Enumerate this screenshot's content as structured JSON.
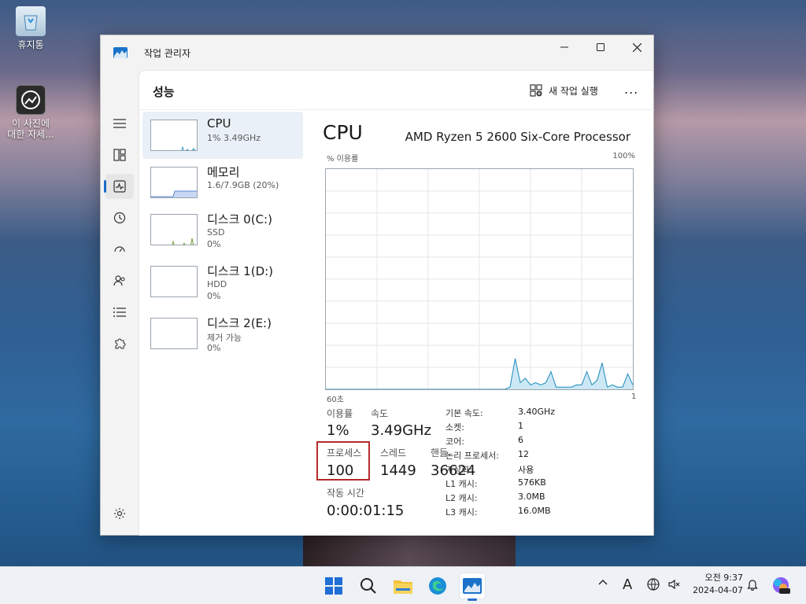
{
  "desktop": {
    "recycle_label": "휴지통",
    "photo_label_line1": "이 사진에",
    "photo_label_line2": "대한 자세..."
  },
  "window": {
    "title": "작업 관리자",
    "page_title": "성능",
    "run_task_label": "새 작업 실행",
    "more_label": "..."
  },
  "perf_items": [
    {
      "name": "CPU",
      "sub1": "1% 3.49GHz",
      "sub2": ""
    },
    {
      "name": "메모리",
      "sub1": "1.6/7.9GB (20%)",
      "sub2": ""
    },
    {
      "name": "디스크 0(C:)",
      "sub1": "SSD",
      "sub2": "0%"
    },
    {
      "name": "디스크 1(D:)",
      "sub1": "HDD",
      "sub2": "0%"
    },
    {
      "name": "디스크 2(E:)",
      "sub1": "제거 가능",
      "sub2": "0%"
    }
  ],
  "cpu": {
    "title": "CPU",
    "model": "AMD Ryzen 5 2600 Six-Core Processor",
    "y_axis_label": "% 이용률",
    "y_max_label": "100%",
    "x_left_label": "60초",
    "x_right_label": "1",
    "usage_label": "이용률",
    "usage_value": "1%",
    "speed_label": "속도",
    "speed_value": "3.49GHz",
    "process_label": "프로세스",
    "process_value": "100",
    "thread_label": "스레드",
    "thread_value": "1449",
    "handle_label": "핸들",
    "handle_value": "36624",
    "uptime_label": "작동 시간",
    "uptime_value": "0:00:01:15",
    "info": [
      {
        "key": "기본 속도:",
        "value": "3.40GHz"
      },
      {
        "key": "소켓:",
        "value": "1"
      },
      {
        "key": "코어:",
        "value": "6"
      },
      {
        "key": "논리 프로세서:",
        "value": "12"
      },
      {
        "key": "가상화:",
        "value": "사용"
      },
      {
        "key": "L1 캐시:",
        "value": "576KB"
      },
      {
        "key": "L2 캐시:",
        "value": "3.0MB"
      },
      {
        "key": "L3 캐시:",
        "value": "16.0MB"
      }
    ]
  },
  "cpu_graph_values": [
    0,
    0,
    0,
    0,
    0,
    0,
    0,
    0,
    0,
    0,
    0,
    0,
    0,
    0,
    0,
    0,
    0,
    0,
    0,
    0,
    0,
    0,
    0,
    0,
    0,
    0,
    0,
    0,
    0,
    0,
    0,
    0,
    0,
    0,
    0,
    0,
    1,
    14,
    3,
    5,
    2,
    3,
    2,
    3,
    8,
    1,
    1,
    1,
    1,
    2,
    2,
    8,
    2,
    4,
    12,
    1,
    2,
    1,
    1,
    7,
    2
  ],
  "taskbar": {
    "clock_line1": "오전 9:37",
    "clock_line2": "2024-04-07",
    "ime_label": "A"
  },
  "colors": {
    "accent": "#1a6ec9",
    "graph_fill": "#cde8f5",
    "graph_line": "#1a8bb9",
    "highlight": "#b52a2a"
  }
}
